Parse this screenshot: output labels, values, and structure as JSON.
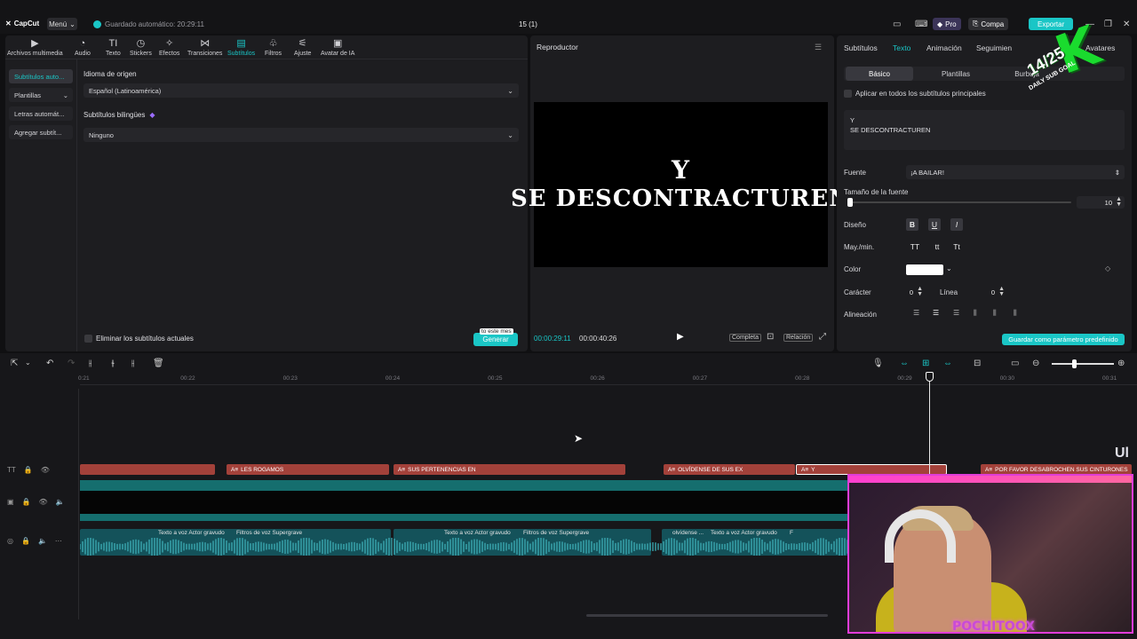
{
  "app": {
    "logo": "CapCut",
    "menu": "Menú",
    "autosave": "Guardado automático: 20:29:11",
    "project": "15 (1)",
    "pro": "Pro",
    "share": "Compa",
    "export": "Exportar"
  },
  "toolbar": [
    {
      "icon": "media-icon",
      "glyph": "▶",
      "label": "Archivos multimedia"
    },
    {
      "icon": "audio-icon",
      "glyph": "◔",
      "label": "Audio"
    },
    {
      "icon": "text-icon",
      "glyph": "TI",
      "label": "Texto"
    },
    {
      "icon": "sticker-icon",
      "glyph": "◷",
      "label": "Stickers"
    },
    {
      "icon": "effects-icon",
      "glyph": "✧",
      "label": "Efectos"
    },
    {
      "icon": "transitions-icon",
      "glyph": "⋈",
      "label": "Transiciones"
    },
    {
      "icon": "subtitles-icon",
      "glyph": "▤",
      "label": "Subtítulos"
    },
    {
      "icon": "filters-icon",
      "glyph": "♧",
      "label": "Filtros"
    },
    {
      "icon": "adjust-icon",
      "glyph": "⚟",
      "label": "Ajuste"
    },
    {
      "icon": "ai-avatar-icon",
      "glyph": "▣",
      "label": "Avatar de IA"
    }
  ],
  "subnav": [
    "Subtítulos auto...",
    "Plantillas",
    "Letras automát...",
    "Agregar subtít..."
  ],
  "left": {
    "source_lang_label": "Idioma de origen",
    "source_lang_value": "Español (Latinoamérica)",
    "bilingual_label": "Subtítulos bilingües",
    "bilingual_value": "Ninguno",
    "remove_label": "Eliminar los subtítulos actuales",
    "generate": "Generar",
    "tooltip": "to este mes"
  },
  "player": {
    "title": "Reproductor",
    "line1": "Y",
    "line2": "SE DESCONTRACTUREN",
    "time_current": "00:00:29:11",
    "time_total": "00:00:40:26",
    "full": "Completa",
    "ratio": "Relación"
  },
  "right": {
    "tabs": [
      "Subtítulos",
      "Texto",
      "Animación",
      "Seguimien",
      "Avatares"
    ],
    "seg": [
      "Básico",
      "Plantillas",
      "Burbuja"
    ],
    "apply_all": "Aplicar en todos los subtítulos principales",
    "text_line1": "Y",
    "text_line2": "SE DESCONTRACTUREN",
    "font_label": "Fuente",
    "font_value": "¡A BAILAR!",
    "size_label": "Tamaño de la fuente",
    "size_value": "10",
    "design_label": "Diseño",
    "case_label": "May./min.",
    "case_opts": [
      "TT",
      "tt",
      "Tt"
    ],
    "color_label": "Color",
    "char_label": "Carácter",
    "char_value": "0",
    "line_label": "Línea",
    "line_value": "0",
    "align_label": "Alineación",
    "save_preset": "Guardar como parámetro predefinido"
  },
  "timeline": {
    "ticks": [
      "0:21",
      "00:22",
      "00:23",
      "00:24",
      "00:25",
      "00:26",
      "00:27",
      "00:28",
      "00:29",
      "00:30",
      "00:31"
    ],
    "text_clips": [
      "",
      "LES ROGAMOS",
      "SUS PERTENENCIAS EN",
      "OLVÍDENSE DE SUS EX",
      "Y",
      "POR FAVOR DESABROCHEN SUS CINTURONES"
    ],
    "audio_labels": [
      "Texto a voz Actor gravudo",
      "Filtros de voz Supergrave",
      "Texto a voz Actor gravudo",
      "Filtros de voz Supergrave",
      "olvídense ...",
      "Texto a voz Actor gravudo",
      "F"
    ]
  },
  "overlay": {
    "goal_main": "14/25",
    "goal_sub": "DAILY SUB GOAL",
    "goal_letter": "K",
    "streamer": "POCHITOOX",
    "edge_text": "Ul"
  },
  "colors": {
    "accent": "#1ac6c6",
    "text_clip": "#a3413a",
    "cam_border": "#e03cd8"
  }
}
